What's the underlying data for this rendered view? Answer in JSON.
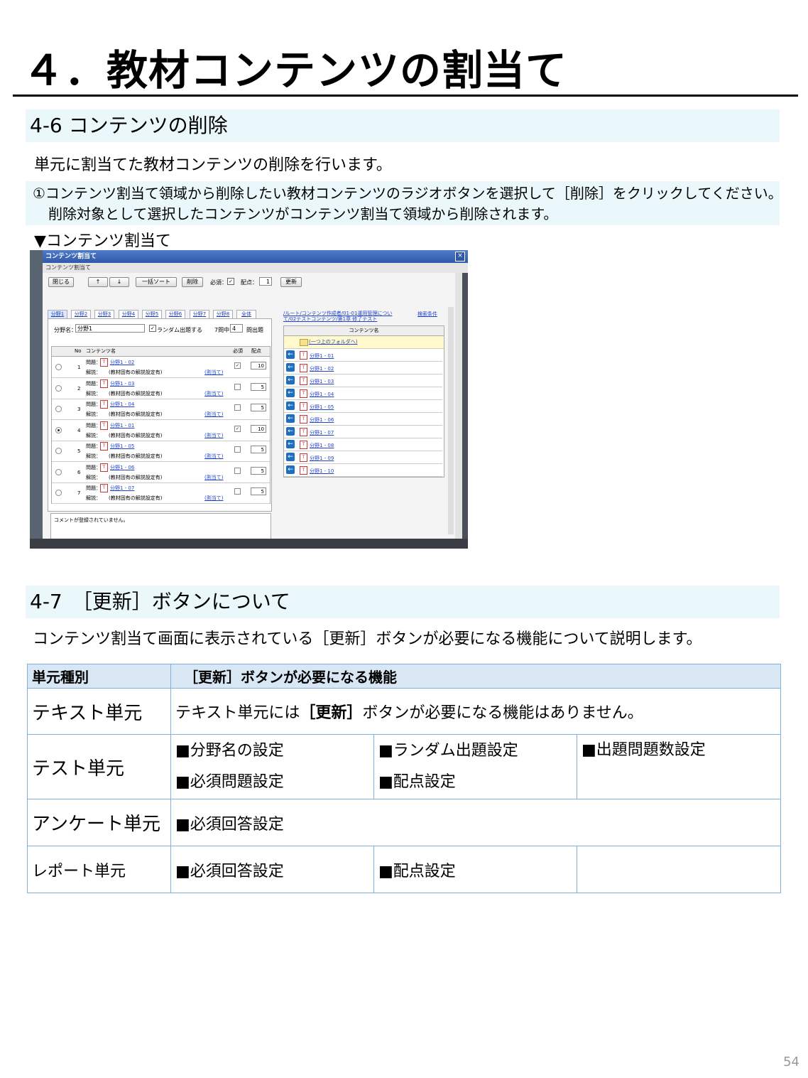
{
  "main_title": "４．教材コンテンツの割当て",
  "section46": {
    "heading": "4-6  コンテンツの削除",
    "intro": "単元に割当てた教材コンテンツの削除を行います。",
    "step_line1": "①コンテンツ割当て領域から削除したい教材コンテンツのラジオボタンを選択して［削除］をクリックしてください。",
    "step_line2": "削除対象として選択したコンテンツがコンテンツ割当て領域から削除されます。",
    "caption": "▼コンテンツ割当て"
  },
  "screenshot": {
    "title": "コンテンツ割当て",
    "subtitle": "コンテンツ割当て",
    "buttons": {
      "close": "閉じる",
      "up": "↑",
      "down": "↓",
      "sort": "一括ソート",
      "delete": "削除",
      "required_label": "必須：",
      "points_label": "配点：",
      "points_value": "1",
      "update": "更新"
    },
    "tabs": [
      "分野1",
      "分野2",
      "分野3",
      "分野4",
      "分野5",
      "分野6",
      "分野7",
      "分野8",
      "全体"
    ],
    "field_label": "分野名：",
    "field_value": "分野1",
    "random_label": "ランダム出題する",
    "count_prefix": "7問中",
    "count_value": "4",
    "count_suffix": "問出題",
    "col_no": "No",
    "col_name": "コンテンツ名",
    "col_required": "必須",
    "col_points": "配点",
    "q_label": "問題：",
    "a_label": "解説：",
    "a_text": "(教材固有の解説設定有)",
    "assign_link": "(割当て)",
    "rows": [
      {
        "no": "1",
        "name": "分野1 - 02",
        "points": "10"
      },
      {
        "no": "2",
        "name": "分野1 - 03",
        "points": "5"
      },
      {
        "no": "3",
        "name": "分野1 - 04",
        "points": "5"
      },
      {
        "no": "4",
        "name": "分野1 - 01",
        "points": "10"
      },
      {
        "no": "5",
        "name": "分野1 - 05",
        "points": "5"
      },
      {
        "no": "6",
        "name": "分野1 - 06",
        "points": "5"
      },
      {
        "no": "7",
        "name": "分野1 - 07",
        "points": "5"
      }
    ],
    "comment": "コメントが登録されていません。",
    "breadcrumb_line1": "/ルート/コンテンツ作成者/01-01運用管理につい",
    "breadcrumb_line2": "て/02テストコンテンツ/第1章 修了テスト",
    "search_link": "検索条件",
    "right_header": "コンテンツ名",
    "parent_folder": "(一つ上のフォルダへ)",
    "right_items": [
      "分野1 - 01",
      "分野1 - 02",
      "分野1 - 03",
      "分野1 - 04",
      "分野1 - 05",
      "分野1 - 06",
      "分野1 - 07",
      "分野1 - 08",
      "分野1 - 09",
      "分野1 - 10"
    ]
  },
  "section47": {
    "heading": "4-7　［更新］ボタンについて",
    "intro": "コンテンツ割当て画面に表示されている［更新］ボタンが必要になる機能について説明します。"
  },
  "table": {
    "head_col1": "単元種別",
    "head_col2": "［更新］ボタンが必要になる機能",
    "text_unit": "テキスト単元",
    "text_pre": "テキスト単元には",
    "text_bold": "［更新］",
    "text_post": "ボタンが必要になる機能はありません。",
    "test_unit": "テスト単元",
    "test_a": "■分野名の設定",
    "test_b": "■ランダム出題設定",
    "test_c": "■出題問題数設定",
    "test_d": "■必須問題設定",
    "test_e": "■配点設定",
    "survey_unit": "アンケート単元",
    "survey_a": "■必須回答設定",
    "report_unit": "レポート単元",
    "report_a": "■必須回答設定",
    "report_b": "■配点設定"
  },
  "page_number": "54"
}
